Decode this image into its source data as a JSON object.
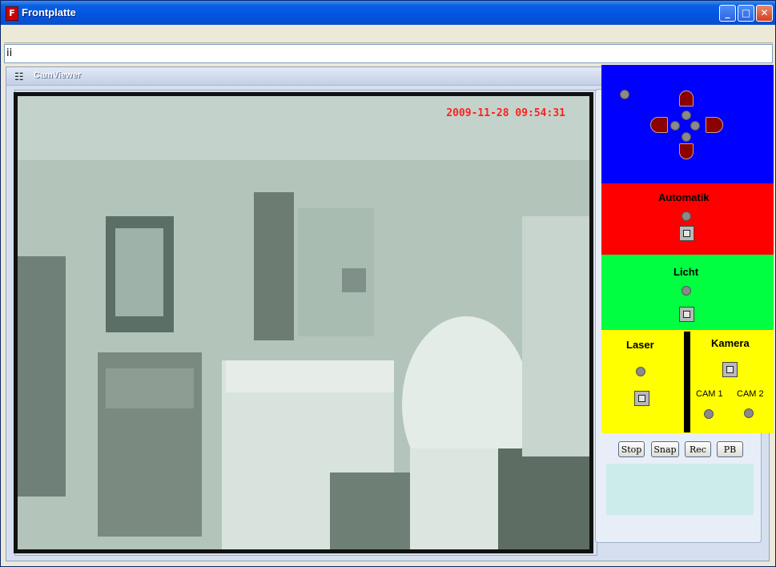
{
  "window": {
    "title": "Frontplatte",
    "app_icon_glyph": "F",
    "controls": {
      "minimize": "_",
      "maximize": "□",
      "close": "✕"
    }
  },
  "input_line": {
    "value": "ii"
  },
  "camviewer": {
    "title": "CamViewer",
    "icon": "binoculars-icon",
    "timestamp": "2009-11-28 09:54:31"
  },
  "buttons": {
    "stop": "Stop",
    "snap": "Snap",
    "rec": "Rec",
    "pb": "PB"
  },
  "sections": {
    "automatik": {
      "label": "Automatik"
    },
    "licht": {
      "label": "Licht"
    },
    "laser": {
      "label": "Laser"
    },
    "kamera": {
      "label": "Kamera",
      "cam1": "CAM 1",
      "cam2": "CAM 2"
    }
  },
  "colors": {
    "direction_panel": "#0000ff",
    "automatik_panel": "#ff0000",
    "licht_panel": "#00ff40",
    "laser_kamera_panel": "#ffff00",
    "timestamp": "#ff2020",
    "arrow": "#8b0000"
  }
}
